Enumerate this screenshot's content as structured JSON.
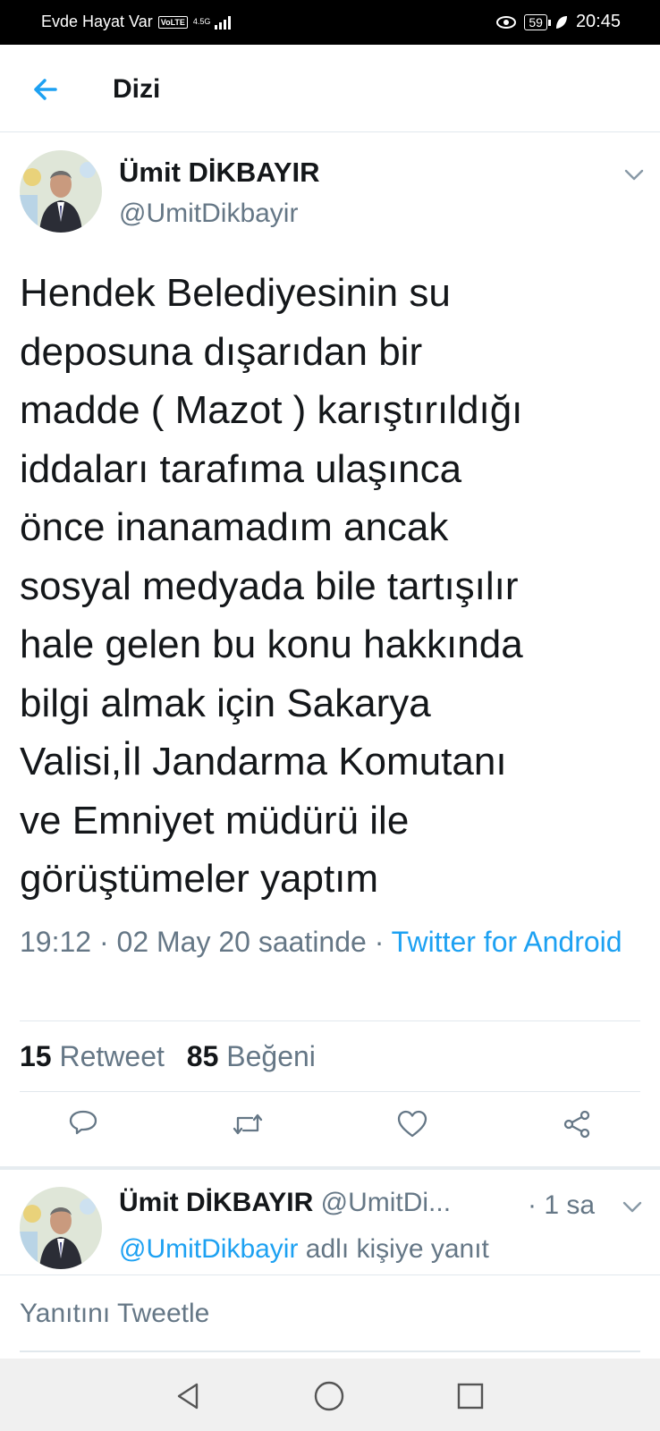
{
  "status_bar": {
    "carrier": "Evde Hayat Var",
    "volte": "VoLTE",
    "network": "4.5G",
    "battery": "59",
    "time": "20:45"
  },
  "header": {
    "title": "Dizi"
  },
  "tweet": {
    "author_name": "Ümit DİKBAYIR",
    "author_handle": "@UmitDikbayir",
    "text": "Hendek Belediyesinin su\ndeposuna dışarıdan bir\nmadde ( Mazot ) karıştırıldığı\niddaları tarafıma ulaşınca\nönce inanamadım ancak\nsosyal medyada bile tartışılır\nhale gelen bu konu hakkında\nbilgi almak için Sakarya\nValisi,İl Jandarma Komutanı\nve Emniyet müdürü ile\ngörüştümeler yaptım",
    "timestamp": "19:12 · 02 May 20 saatinde · ",
    "source": "Twitter for Android",
    "retweet_count": "15",
    "retweet_label": "Retweet",
    "like_count": "85",
    "like_label": "Beğeni"
  },
  "reply": {
    "author_name": "Ümit DİKBAYIR",
    "author_handle": "@UmitDi...",
    "time": "· 1 sa",
    "reply_to_handle": "@UmitDikbayir",
    "reply_to_suffix": " adlı kişiye yanıt"
  },
  "compose": {
    "placeholder": "Yanıtını Tweetle"
  },
  "colors": {
    "accent": "#1da1f2",
    "secondary_text": "#657786",
    "divider": "#e1e8ed"
  },
  "icons": [
    "back-arrow-icon",
    "chevron-down-icon",
    "reply-icon",
    "retweet-icon",
    "like-icon",
    "share-icon",
    "nav-back-icon",
    "nav-home-icon",
    "nav-recents-icon"
  ]
}
